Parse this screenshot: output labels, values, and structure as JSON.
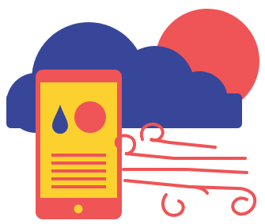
{
  "illustration": {
    "subject": "weather-app-illustration",
    "icons": [
      "cloud-icon",
      "sun-icon",
      "phone-icon",
      "raindrop-icon",
      "wind-icon"
    ],
    "colors": {
      "background": "#ffffff",
      "cloud": "#38469a",
      "sun": "#ef5456",
      "phone_body": "#ef5456",
      "phone_screen": "#fcd02f",
      "raindrop": "#38469a",
      "text_lines": "#ef5456",
      "home_button": "#fcd02f",
      "wind": "#ef5456"
    }
  }
}
